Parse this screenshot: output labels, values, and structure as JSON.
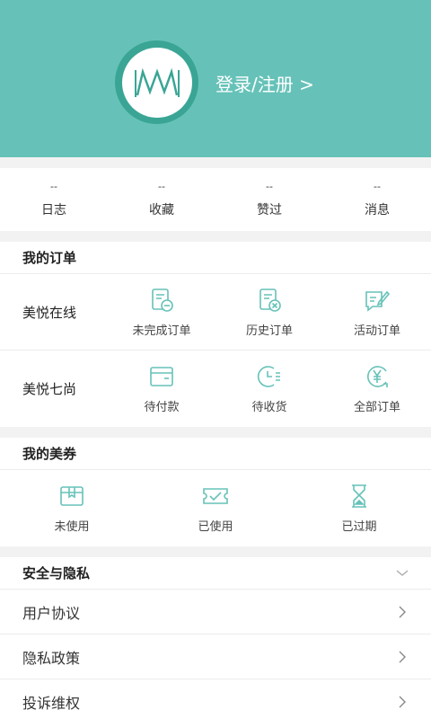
{
  "header": {
    "login_label": "登录/注册 >"
  },
  "stats": [
    {
      "value": "--",
      "label": "日志"
    },
    {
      "value": "--",
      "label": "收藏"
    },
    {
      "value": "--",
      "label": "赞过"
    },
    {
      "value": "--",
      "label": "消息"
    }
  ],
  "orders": {
    "title": "我的订单",
    "rows": [
      {
        "label": "美悦在线",
        "items": [
          {
            "label": "未完成订单",
            "icon": "pending-order-icon"
          },
          {
            "label": "历史订单",
            "icon": "history-order-icon"
          },
          {
            "label": "活动订单",
            "icon": "activity-order-icon"
          }
        ]
      },
      {
        "label": "美悦七尚",
        "items": [
          {
            "label": "待付款",
            "icon": "wallet-icon"
          },
          {
            "label": "待收货",
            "icon": "delivery-clock-icon"
          },
          {
            "label": "全部订单",
            "icon": "yen-icon"
          }
        ]
      }
    ]
  },
  "coupons": {
    "title": "我的美券",
    "items": [
      {
        "label": "未使用",
        "icon": "gift-box-icon"
      },
      {
        "label": "已使用",
        "icon": "used-ticket-icon"
      },
      {
        "label": "已过期",
        "icon": "hourglass-icon"
      }
    ]
  },
  "privacy": {
    "title": "安全与隐私",
    "items": [
      {
        "label": "用户协议"
      },
      {
        "label": "隐私政策"
      },
      {
        "label": "投诉维权"
      }
    ]
  },
  "colors": {
    "accent": "#66c2b8",
    "accent_dark": "#3aa595"
  }
}
